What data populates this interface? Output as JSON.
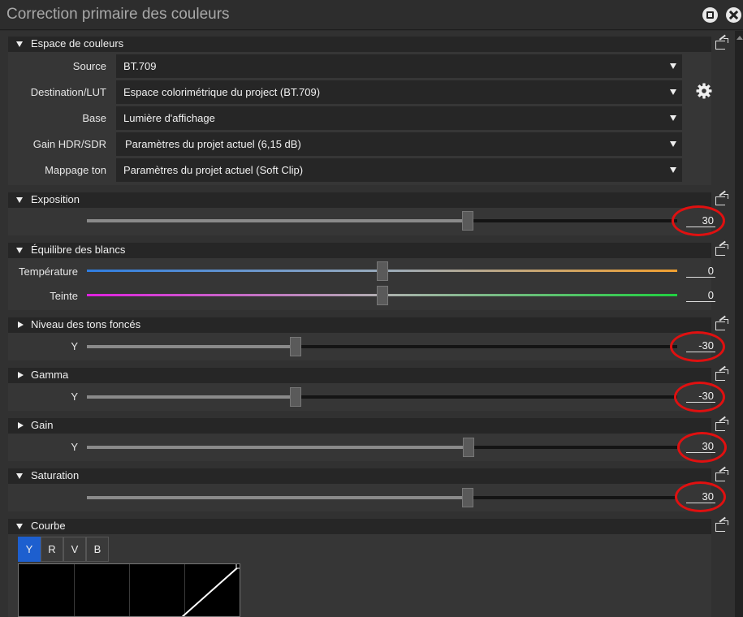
{
  "window": {
    "title": "Correction primaire des couleurs"
  },
  "color_space": {
    "title": "Espace de couleurs",
    "rows": [
      {
        "label": "Source",
        "value": "BT.709"
      },
      {
        "label": "Destination/LUT",
        "value": "Espace colorimétrique du project (BT.709)"
      },
      {
        "label": "Base",
        "value": "Lumière d'affichage"
      },
      {
        "label": "Gain HDR/SDR",
        "value": "Paramètres du projet actuel (6,15 dB)"
      },
      {
        "label": "Mappage ton",
        "value": "Paramètres du projet actuel (Soft Clip)"
      }
    ]
  },
  "exposure": {
    "title": "Exposition",
    "value": "30",
    "level": 0.645
  },
  "white_balance": {
    "title": "Équilibre des blancs",
    "temperature": {
      "label": "Température",
      "value": "0",
      "level": 0.5
    },
    "tint": {
      "label": "Teinte",
      "value": "0",
      "level": 0.5
    }
  },
  "shadows": {
    "title": "Niveau des tons foncés",
    "channel": "Y",
    "value": "-30",
    "level": 0.353
  },
  "gamma": {
    "title": "Gamma",
    "channel": "Y",
    "value": "-30",
    "level": 0.353
  },
  "gain": {
    "title": "Gain",
    "channel": "Y",
    "value": "30",
    "level": 0.647
  },
  "saturation": {
    "title": "Saturation",
    "value": "30",
    "level": 0.645
  },
  "curve": {
    "title": "Courbe",
    "tabs": [
      "Y",
      "R",
      "V",
      "B"
    ],
    "active_tab": "Y"
  },
  "colors": {
    "highlight": "#e01010",
    "active_tab": "#1d5fcf"
  }
}
